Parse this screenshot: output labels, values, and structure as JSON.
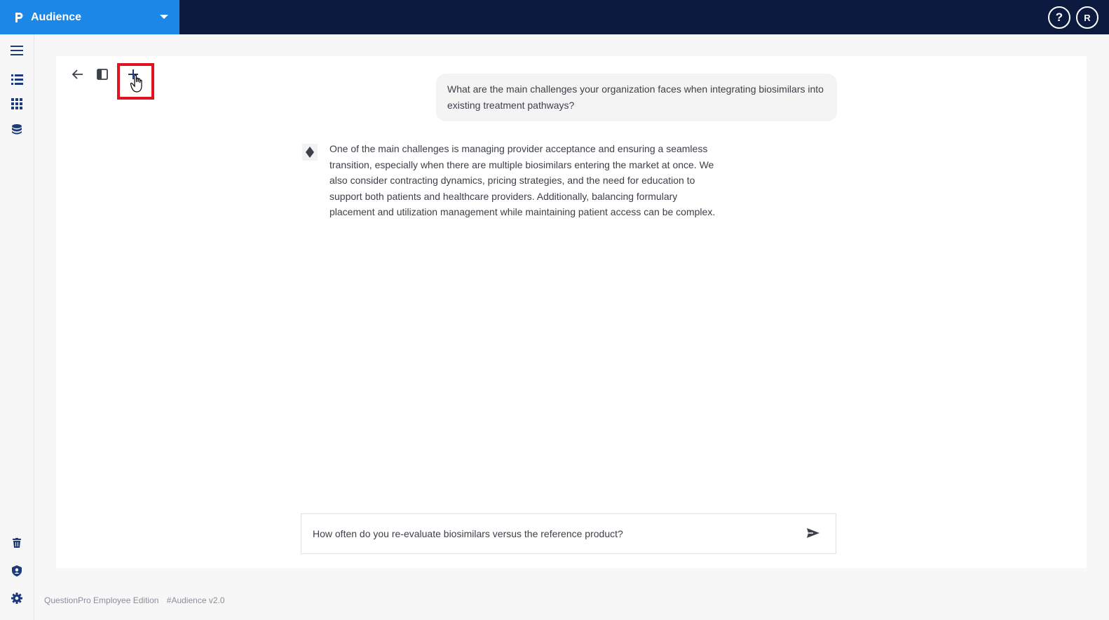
{
  "header": {
    "app_name": "Audience",
    "help_label": "?",
    "avatar_initial": "R",
    "brand_color": "#1b87e6",
    "bar_color": "#0c1a40"
  },
  "sidebar": {
    "items": [
      {
        "icon": "menu-icon"
      },
      {
        "icon": "list-icon"
      },
      {
        "icon": "grid-icon"
      },
      {
        "icon": "database-icon"
      },
      {
        "icon": "trash-icon"
      },
      {
        "icon": "shield-icon"
      },
      {
        "icon": "gear-icon"
      }
    ]
  },
  "toolbar": {
    "back_icon": "arrow-left-icon",
    "panel_icon": "sidebar-toggle-icon",
    "new_chat_icon": "plus-icon",
    "highlight_color": "#e0141e"
  },
  "conversation": {
    "user_message": "What are the main challenges your organization faces when integrating biosimilars into existing treatment pathways?",
    "ai_message": "One of the main challenges is managing provider acceptance and ensuring a seamless transition, especially when there are multiple biosimilars entering the market at once. We also consider contracting dynamics, pricing strategies, and the need for education to support both patients and healthcare providers. Additionally, balancing formulary placement and utilization management while maintaining patient access can be complex."
  },
  "composer": {
    "value": "How often do you re-evaluate biosimilars versus the reference product?",
    "send_icon": "send-icon"
  },
  "footer": {
    "edition": "QuestionPro Employee Edition",
    "version": "#Audience v2.0"
  }
}
